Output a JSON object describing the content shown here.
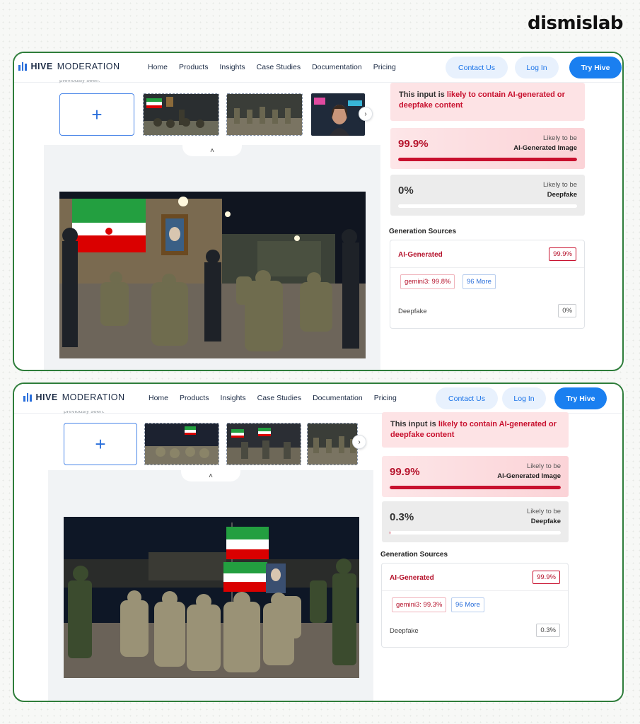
{
  "watermark": "dismislab",
  "nav": {
    "logo_strong": "HIVE",
    "logo_light": "MODERATION",
    "menu": [
      "Home",
      "Products",
      "Insights",
      "Case Studies",
      "Documentation",
      "Pricing"
    ],
    "contact": "Contact Us",
    "login": "Log In",
    "try": "Try Hive"
  },
  "cut_text": "previously seen.",
  "upload_plus": "+",
  "next_arrow": "›",
  "collapse_arrow": "˄",
  "colors": {
    "frame": "#2e7d3a",
    "brand_blue": "#1a7ff0",
    "alert_red": "#c8102e"
  },
  "panels": [
    {
      "alert_prefix": "This input is ",
      "alert_highlight": "likely to contain AI-generated or deepfake content",
      "ai_score": "99.9%",
      "ai_score_fraction": 0.999,
      "ai_sub1": "Likely to be",
      "ai_sub2": "AI-Generated Image",
      "df_score": "0%",
      "df_score_fraction": 0.0,
      "df_sub1": "Likely to be",
      "df_sub2": "Deepfake",
      "sources_title": "Generation Sources",
      "src_label": "AI-Generated",
      "src_value": "99.9%",
      "model_chip": "gemini3: 99.8%",
      "more_chip": "96 More",
      "deepfake_label": "Deepfake",
      "deepfake_value": "0%"
    },
    {
      "alert_prefix": "This input is ",
      "alert_highlight": "likely to contain AI-generated or deepfake content",
      "ai_score": "99.9%",
      "ai_score_fraction": 0.999,
      "ai_sub1": "Likely to be",
      "ai_sub2": "AI-Generated Image",
      "df_score": "0.3%",
      "df_score_fraction": 0.003,
      "df_sub1": "Likely to be",
      "df_sub2": "Deepfake",
      "sources_title": "Generation Sources",
      "src_label": "AI-Generated",
      "src_value": "99.9%",
      "model_chip": "gemini3: 99.3%",
      "more_chip": "96 More",
      "deepfake_label": "Deepfake",
      "deepfake_value": "0.3%"
    }
  ]
}
